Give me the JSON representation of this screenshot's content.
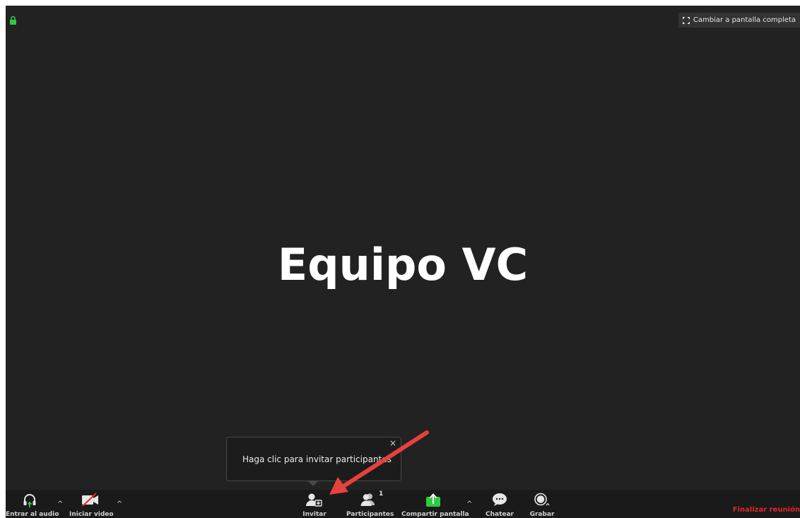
{
  "meeting": {
    "name": "Equipo VC"
  },
  "header": {
    "fullscreen_label": "Cambiar a pantalla completa",
    "fullscreen_icon": "expand-icon",
    "lock_icon": "lock-icon"
  },
  "tooltip": {
    "text": "Haga clic para invitar participantes",
    "close": "×"
  },
  "toolbar": {
    "audio_label": "Entrar al audio",
    "video_label": "Iniciar video",
    "invite_label": "Invitar",
    "participants_label": "Participantes",
    "participants_count": "1",
    "share_label": "Compartir pantalla",
    "chat_label": "Chatear",
    "record_label": "Grabar",
    "end_label": "Finalizar reunión",
    "caret": "^"
  },
  "colors": {
    "background": "#222222",
    "toolbar": "#1a1a1a",
    "share_green": "#2ecc40",
    "end_red": "#e02828",
    "lock_green": "#2ecc40",
    "arrow_red": "#e8413c"
  }
}
